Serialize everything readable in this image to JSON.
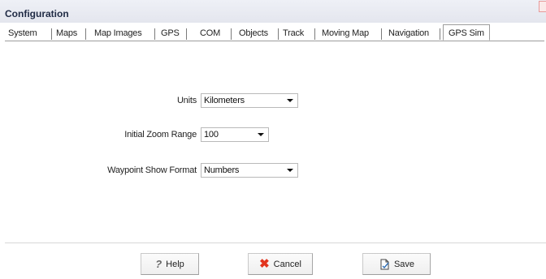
{
  "window": {
    "title": "Configuration"
  },
  "tabs": [
    {
      "label": "System"
    },
    {
      "label": "Maps"
    },
    {
      "label": "Map Images"
    },
    {
      "label": "GPS"
    },
    {
      "label": "COM"
    },
    {
      "label": "Objects"
    },
    {
      "label": "Track"
    },
    {
      "label": "Moving Map"
    },
    {
      "label": "Navigation"
    },
    {
      "label": "GPS Sim",
      "active": true
    }
  ],
  "form": {
    "units": {
      "label": "Units",
      "value": "Kilometers"
    },
    "zoom": {
      "label": "Initial Zoom Range",
      "value": "100"
    },
    "waypoint": {
      "label": "Waypoint Show Format",
      "value": "Numbers"
    }
  },
  "buttons": {
    "help": {
      "label": "Help",
      "icon": "help-question-icon"
    },
    "cancel": {
      "label": "Cancel",
      "icon": "cancel-x-icon"
    },
    "save": {
      "label": "Save",
      "icon": "save-document-icon"
    }
  },
  "colors": {
    "cancel_icon": "#e2341e",
    "title_text": "#1f2a44"
  }
}
